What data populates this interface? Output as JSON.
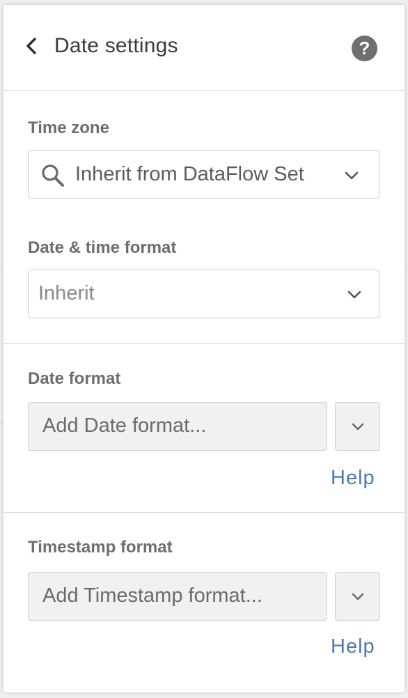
{
  "header": {
    "title": "Date settings",
    "help_glyph": "?"
  },
  "time_zone": {
    "label": "Time zone",
    "value": "Inherit from DataFlow Set"
  },
  "datetime_format": {
    "label": "Date & time format",
    "value": "Inherit"
  },
  "date_format": {
    "label": "Date format",
    "placeholder": "Add Date format...",
    "help_label": "Help"
  },
  "timestamp_format": {
    "label": "Timestamp format",
    "placeholder": "Add Timestamp format...",
    "help_label": "Help"
  },
  "icons": {
    "back": "chevron-left-icon",
    "help": "question-circle-icon",
    "search": "search-icon",
    "dropdown": "chevron-down-icon"
  },
  "colors": {
    "link": "#4a7bb0",
    "help_circle": "#6f6f6f",
    "field_bg": "#f1f1f1"
  }
}
